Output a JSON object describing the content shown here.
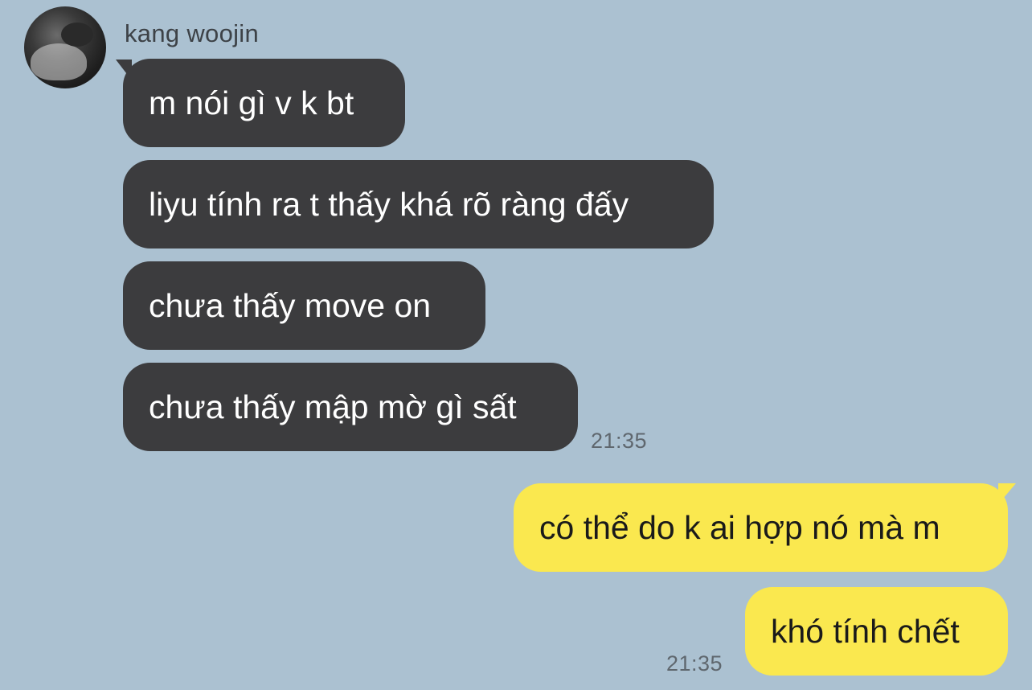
{
  "contact": {
    "name": "kang woojin"
  },
  "messages": {
    "incoming": [
      {
        "text": "m nói gì v k bt"
      },
      {
        "text": "liyu tính ra t thấy khá rõ ràng đấy"
      },
      {
        "text": "chưa thấy move on"
      },
      {
        "text": "chưa thấy mập mờ gì sất"
      }
    ],
    "incoming_time": "21:35",
    "outgoing": [
      {
        "text": "có thể do k ai hợp nó mà m"
      },
      {
        "text": "khó tính chết"
      }
    ],
    "outgoing_time": "21:35"
  },
  "colors": {
    "background": "#abc1d1",
    "incoming_bubble": "#3c3c3e",
    "outgoing_bubble": "#fae84f"
  },
  "icons": {
    "avatar": "profile-photo"
  }
}
